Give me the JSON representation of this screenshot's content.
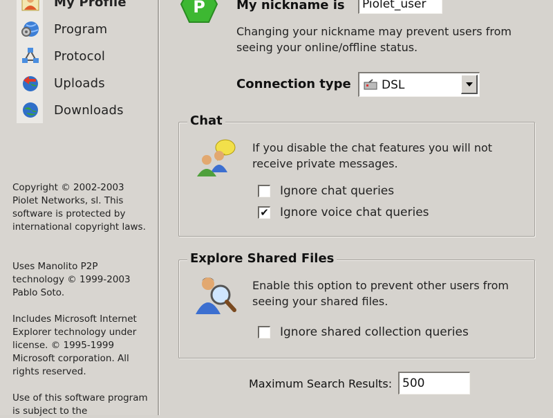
{
  "sidebar": {
    "items": [
      {
        "label": "My Profile",
        "icon": "user-icon"
      },
      {
        "label": "Program",
        "icon": "globe-gear-icon"
      },
      {
        "label": "Protocol",
        "icon": "network-icon"
      },
      {
        "label": "Uploads",
        "icon": "globe-upload-icon"
      },
      {
        "label": "Downloads",
        "icon": "globe-download-icon"
      }
    ],
    "copyright": "Copyright © 2002-2003 Piolet Networks, sl. This software is protected by international copyright laws.",
    "manolito": "Uses Manolito P2P technology © 1999-2003 Pablo Soto.",
    "microsoft": "Includes Microsoft Internet Explorer technology under license. © 1995-1999 Microsoft corporation. All rights reserved.",
    "terms": "Use of this software program is subject to the"
  },
  "profile": {
    "nickname_label": "My nickname is",
    "nickname_value": "Piolet_user",
    "nickname_note": "Changing your nickname may prevent users from seeing your online/offline status.",
    "connection_label": "Connection type",
    "connection_value": "DSL"
  },
  "chat": {
    "title": "Chat",
    "description": "If you disable the chat features you will not receive private messages.",
    "options": [
      {
        "label": "Ignore chat queries",
        "checked": false
      },
      {
        "label": "Ignore voice chat queries",
        "checked": true
      }
    ]
  },
  "shared": {
    "title": "Explore Shared Files",
    "description": "Enable this option to prevent other users from seeing your shared files.",
    "options": [
      {
        "label": "Ignore shared collection queries",
        "checked": false
      }
    ]
  },
  "search": {
    "label": "Maximum Search Results:",
    "value": "500"
  },
  "colors": {
    "background": "#d6d3ce",
    "logo_green": "#3db832"
  }
}
